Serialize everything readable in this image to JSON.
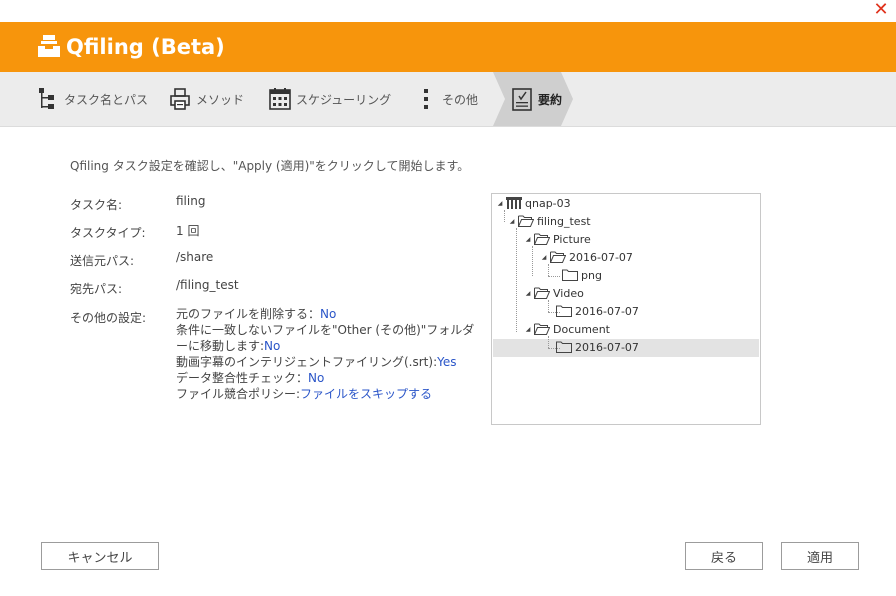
{
  "window": {
    "close_glyph": "✕"
  },
  "header": {
    "title": "Qfiling (Beta)",
    "logo_icon": "inbox-tray-icon"
  },
  "steps": [
    {
      "label": "タスク名とパス",
      "icon": "folder-tree-icon"
    },
    {
      "label": "メソッド",
      "icon": "printer-icon"
    },
    {
      "label": "スケジューリング",
      "icon": "calendar-icon"
    },
    {
      "label": "その他",
      "icon": "more-vertical-icon"
    },
    {
      "label": "要約",
      "icon": "checklist-icon",
      "active": true
    }
  ],
  "summary": {
    "intro": "Qfiling タスク設定を確認し、\"Apply (適用)\"をクリックして開始します。",
    "task_name_label": "タスク名:",
    "task_name_value": "filing",
    "task_type_label": "タスクタイプ:",
    "task_type_value": "1 回",
    "source_label": "送信元パス:",
    "source_value": "/share",
    "dest_label": "宛先パス:",
    "dest_value": "/filing_test",
    "other_label": "その他の設定:",
    "other": {
      "delete_label": "元のファイルを削除する：",
      "delete_value": "No",
      "move_label_1": "条件に一致しないファイルを\"Other (その他)\"フォルダ",
      "move_label_2": "ーに移動します:",
      "move_value": "No",
      "srt_label": "動画字幕のインテリジェントファイリング(.srt):",
      "srt_value": "Yes",
      "integrity_label": "データ整合性チェック：",
      "integrity_value": "No",
      "conflict_label": "ファイル競合ポリシー:",
      "conflict_value": "ファイルをスキップする"
    }
  },
  "tree": {
    "nodes": [
      {
        "label": "qnap-03",
        "icon": "nas-server-icon",
        "expanded": true
      },
      {
        "label": "filing_test",
        "icon": "folder-open-icon",
        "expanded": true
      },
      {
        "label": "Picture",
        "icon": "folder-open-icon",
        "expanded": true
      },
      {
        "label": "2016-07-07",
        "icon": "folder-open-icon",
        "expanded": true
      },
      {
        "label": "png",
        "icon": "folder-icon"
      },
      {
        "label": "Video",
        "icon": "folder-open-icon",
        "expanded": true
      },
      {
        "label": "2016-07-07",
        "icon": "folder-icon"
      },
      {
        "label": "Document",
        "icon": "folder-open-icon",
        "expanded": true
      },
      {
        "label": "2016-07-07",
        "icon": "folder-icon",
        "selected": true
      }
    ]
  },
  "buttons": {
    "cancel": "キャンセル",
    "back": "戻る",
    "apply": "適用"
  },
  "colors": {
    "accent": "#f7950c",
    "link_blue": "#2a55c8",
    "close_red": "#e0321c"
  }
}
